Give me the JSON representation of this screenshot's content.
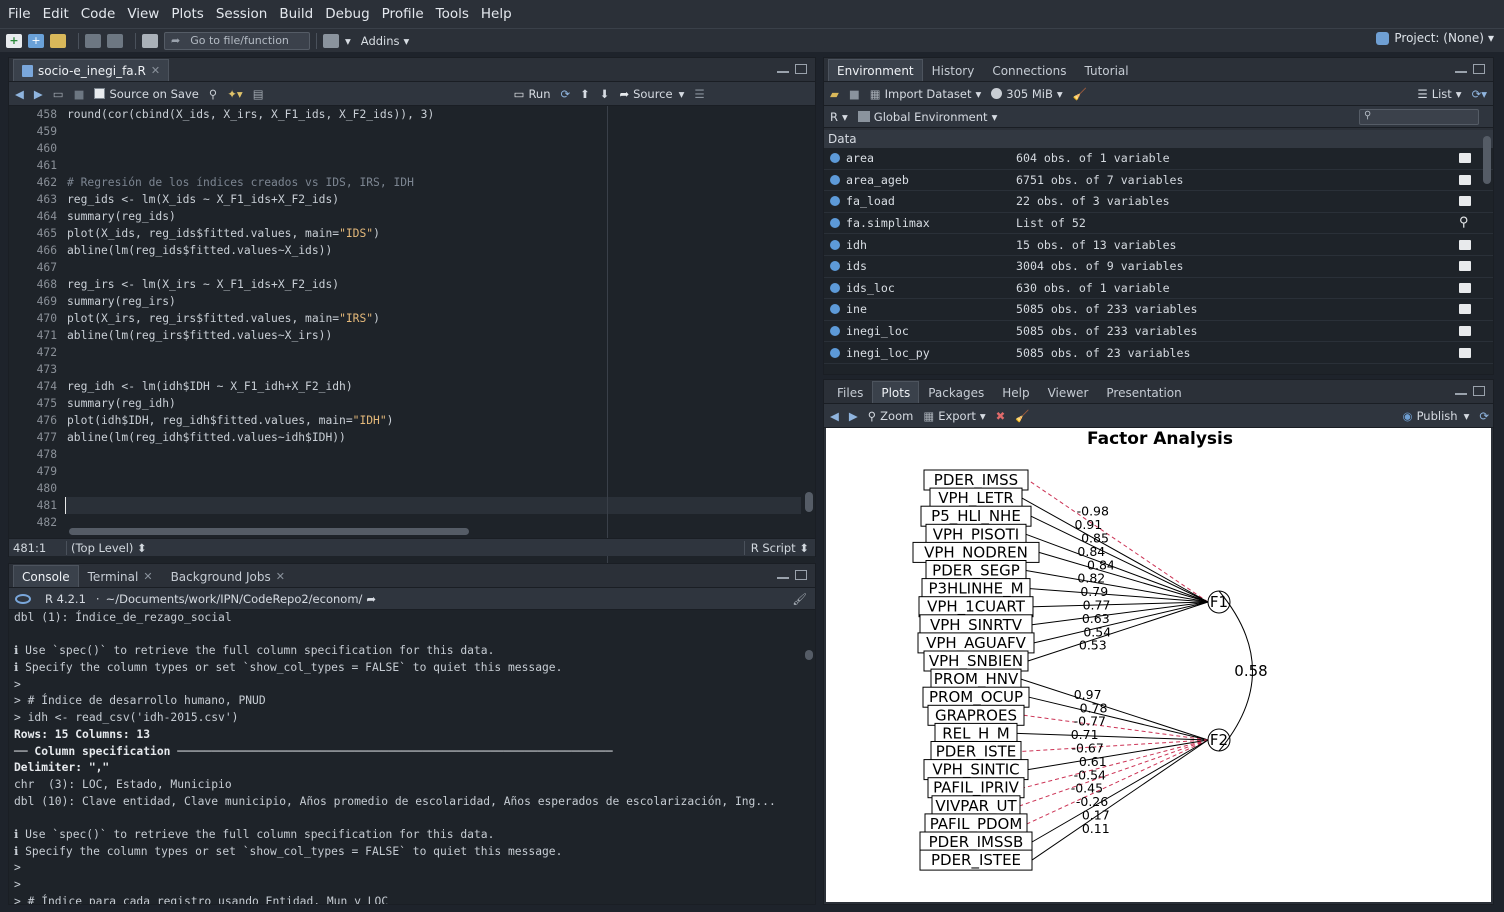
{
  "menu": [
    "File",
    "Edit",
    "Code",
    "View",
    "Plots",
    "Session",
    "Build",
    "Debug",
    "Profile",
    "Tools",
    "Help"
  ],
  "toolbar": {
    "goto_placeholder": "Go to file/function",
    "addins": "Addins",
    "project": "Project: (None)"
  },
  "editor": {
    "tab": "socio-e_inegi_fa.R",
    "source_on_save": "Source on Save",
    "run": "Run",
    "source": "Source",
    "status_pos": "481:1",
    "status_level": "(Top Level)",
    "status_type": "R Script",
    "lines": [
      {
        "n": "458",
        "t": "round(cor(cbind(X_ids, X_irs, X_F1_ids, X_F2_ids)), 3)"
      },
      {
        "n": "459",
        "t": ""
      },
      {
        "n": "460",
        "t": ""
      },
      {
        "n": "461",
        "t": ""
      },
      {
        "n": "462",
        "t": "# Regresión de los índices creados vs IDS, IRS, IDH",
        "c": "cmt"
      },
      {
        "n": "463",
        "t": "reg_ids <- lm(X_ids ~ X_F1_ids+X_F2_ids)"
      },
      {
        "n": "464",
        "t": "summary(reg_ids)"
      },
      {
        "n": "465",
        "t": "plot(X_ids, reg_ids$fitted.values, main=",
        "s": "\"IDS\"",
        "e": ")"
      },
      {
        "n": "466",
        "t": "abline(lm(reg_ids$fitted.values~X_ids))"
      },
      {
        "n": "467",
        "t": ""
      },
      {
        "n": "468",
        "t": "reg_irs <- lm(X_irs ~ X_F1_ids+X_F2_ids)"
      },
      {
        "n": "469",
        "t": "summary(reg_irs)"
      },
      {
        "n": "470",
        "t": "plot(X_irs, reg_irs$fitted.values, main=",
        "s": "\"IRS\"",
        "e": ")"
      },
      {
        "n": "471",
        "t": "abline(lm(reg_irs$fitted.values~X_irs))"
      },
      {
        "n": "472",
        "t": ""
      },
      {
        "n": "473",
        "t": ""
      },
      {
        "n": "474",
        "t": "reg_idh <- lm(idh$IDH ~ X_F1_idh+X_F2_idh)"
      },
      {
        "n": "475",
        "t": "summary(reg_idh)"
      },
      {
        "n": "476",
        "t": "plot(idh$IDH, reg_idh$fitted.values, main=",
        "s": "\"IDH\"",
        "e": ")"
      },
      {
        "n": "477",
        "t": "abline(lm(reg_idh$fitted.values~idh$IDH))"
      },
      {
        "n": "478",
        "t": ""
      },
      {
        "n": "479",
        "t": ""
      },
      {
        "n": "480",
        "t": ""
      },
      {
        "n": "481",
        "t": "",
        "cur": true
      },
      {
        "n": "482",
        "t": ""
      }
    ]
  },
  "console": {
    "tabs": [
      "Console",
      "Terminal",
      "Background Jobs"
    ],
    "version": "R 4.2.1",
    "path": "~/Documents/work/IPN/CodeRepo2/econom/",
    "lines": [
      {
        "t": "dbl (1): Índice_de_rezago_social"
      },
      {
        "t": ""
      },
      {
        "t": "ℹ Use `spec()` to retrieve the full column specification for this data."
      },
      {
        "t": "ℹ Specify the column types or set `show_col_types = FALSE` to quiet this message."
      },
      {
        "t": ">"
      },
      {
        "t": "> # Índice de desarrollo humano, PNUD"
      },
      {
        "t": "> idh <- read_csv('idh-2015.csv')"
      },
      {
        "t": "Rows: 15 Columns: 13",
        "c": "bold"
      },
      {
        "t": "── Column specification ────────────────────────────────────────────────────────────────",
        "c": "bold"
      },
      {
        "t": "Delimiter: \",\"",
        "c": "bold"
      },
      {
        "t": "chr  (3): LOC, Estado, Municipio",
        "p": "red"
      },
      {
        "t": "dbl (10): Clave entidad, Clave municipio, Años promedio de escolaridad, Años esperados de escolarización, Ing..."
      },
      {
        "t": ""
      },
      {
        "t": "ℹ Use `spec()` to retrieve the full column specification for this data."
      },
      {
        "t": "ℹ Specify the column types or set `show_col_types = FALSE` to quiet this message."
      },
      {
        "t": ">"
      },
      {
        "t": ">"
      },
      {
        "t": "> # Índice para cada registro usando Entidad, Mun y LOC"
      }
    ]
  },
  "environment": {
    "tabs": [
      "Environment",
      "History",
      "Connections",
      "Tutorial"
    ],
    "import": "Import Dataset",
    "memory": "305 MiB",
    "view": "List",
    "lang": "R",
    "scope": "Global Environment",
    "section": "Data",
    "rows": [
      {
        "name": "area",
        "value": "604 obs. of 1 variable",
        "icon": "grid"
      },
      {
        "name": "area_ageb",
        "value": "6751 obs. of 7 variables",
        "icon": "grid"
      },
      {
        "name": "fa_load",
        "value": "22 obs. of 3 variables",
        "icon": "grid"
      },
      {
        "name": "fa.simplimax",
        "value": "List of  52",
        "icon": "search"
      },
      {
        "name": "idh",
        "value": "15 obs. of 13 variables",
        "icon": "grid"
      },
      {
        "name": "ids",
        "value": "3004 obs. of 9 variables",
        "icon": "grid"
      },
      {
        "name": "ids_loc",
        "value": "630 obs. of 1 variable",
        "icon": "grid"
      },
      {
        "name": "ine",
        "value": "5085 obs. of 233 variables",
        "icon": "grid"
      },
      {
        "name": "inegi_loc",
        "value": "5085 obs. of 233 variables",
        "icon": "grid"
      },
      {
        "name": "inegi_loc_py",
        "value": "5085 obs. of 23 variables",
        "icon": "grid"
      }
    ]
  },
  "files": {
    "tabs": [
      "Files",
      "Plots",
      "Packages",
      "Help",
      "Viewer",
      "Presentation"
    ],
    "zoom": "Zoom",
    "export": "Export",
    "publish": "Publish"
  },
  "diagram": {
    "title": "Factor Analysis",
    "f1": "F1",
    "f2": "F2",
    "corr": "0.58",
    "vars": [
      {
        "name": "PDER_IMSS",
        "load": "-0.98",
        "f": 1,
        "neg": true
      },
      {
        "name": "VPH_LETR",
        "load": "0.91",
        "f": 1
      },
      {
        "name": "P5_HLI_NHE",
        "load": "0.85",
        "f": 1
      },
      {
        "name": "VPH_PISOTI",
        "load": "0.84",
        "f": 1
      },
      {
        "name": "VPH_NODREN",
        "load": "0.84",
        "f": 1
      },
      {
        "name": "PDER_SEGP",
        "load": "0.82",
        "f": 1
      },
      {
        "name": "P3HLINHE_M",
        "load": "0.79",
        "f": 1
      },
      {
        "name": "VPH_1CUART",
        "load": "0.77",
        "f": 1
      },
      {
        "name": "VPH_SINRTV",
        "load": "0.63",
        "f": 1
      },
      {
        "name": "VPH_AGUAFV",
        "load": "0.54",
        "f": 1
      },
      {
        "name": "VPH_SNBIEN",
        "load": "0.53",
        "f": 1
      },
      {
        "name": "PROM_HNV",
        "load": "0.97",
        "f": 2
      },
      {
        "name": "PROM_OCUP",
        "load": "0.78",
        "f": 2
      },
      {
        "name": "GRAPROES",
        "load": "-0.77",
        "f": 2,
        "neg": true
      },
      {
        "name": "REL_H_M",
        "load": "0.71",
        "f": 2
      },
      {
        "name": "PDER_ISTE",
        "load": "-0.67",
        "f": 2,
        "neg": true
      },
      {
        "name": "VPH_SINTIC",
        "load": "0.61",
        "f": 2
      },
      {
        "name": "PAFIL_IPRIV",
        "load": "-0.54",
        "f": 2,
        "neg": true
      },
      {
        "name": "VIVPAR_UT",
        "load": "-0.45",
        "f": 2,
        "neg": true
      },
      {
        "name": "PAFIL_PDOM",
        "load": "-0.26",
        "f": 2,
        "neg": true
      },
      {
        "name": "PDER_IMSSB",
        "load": "0.17",
        "f": 2
      },
      {
        "name": "PDER_ISTEE",
        "load": "0.11",
        "f": 2
      }
    ]
  }
}
